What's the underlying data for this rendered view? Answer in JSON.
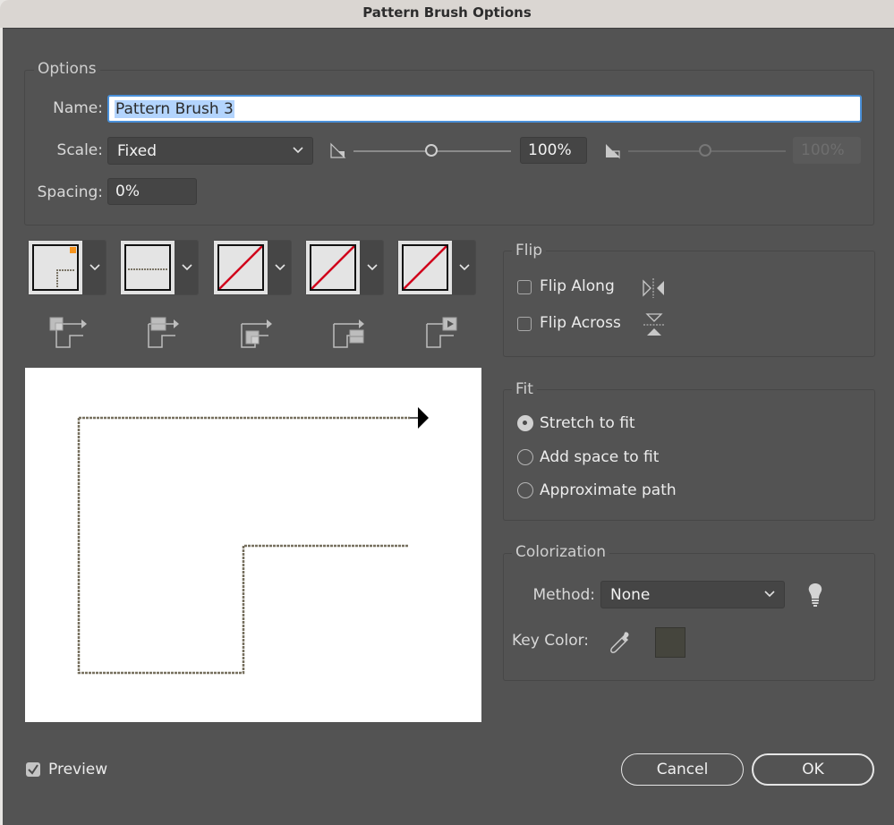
{
  "window": {
    "title": "Pattern Brush Options"
  },
  "options": {
    "group_title": "Options",
    "name_label": "Name:",
    "name_value": "Pattern Brush 3",
    "scale_label": "Scale:",
    "scale_value": "Fixed",
    "scale_slider_1": {
      "percent_value": 100,
      "text": "100%"
    },
    "scale_slider_2": {
      "percent_value": 100,
      "text": "100%",
      "disabled": true
    },
    "spacing_label": "Spacing:",
    "spacing_value": "0%"
  },
  "tiles": [
    {
      "name": "outer-corner-tile",
      "content": "corner-pattern",
      "selected_marker_color": "#f7941d"
    },
    {
      "name": "side-tile",
      "content": "straight-pattern"
    },
    {
      "name": "inner-corner-tile",
      "content": "none"
    },
    {
      "name": "start-tile",
      "content": "none"
    },
    {
      "name": "end-tile",
      "content": "none"
    }
  ],
  "tile_icons": [
    "outer-corner-tile-icon",
    "side-tile-icon",
    "inner-corner-tile-icon",
    "start-tile-icon",
    "end-tile-icon"
  ],
  "flip": {
    "group_title": "Flip",
    "flip_along": {
      "label": "Flip Along",
      "checked": false
    },
    "flip_across": {
      "label": "Flip Across",
      "checked": false
    }
  },
  "fit": {
    "group_title": "Fit",
    "options": [
      {
        "label": "Stretch to fit",
        "selected": true
      },
      {
        "label": "Add space to fit",
        "selected": false
      },
      {
        "label": "Approximate path",
        "selected": false
      }
    ]
  },
  "colorization": {
    "group_title": "Colorization",
    "method_label": "Method:",
    "method_value": "None",
    "key_color_label": "Key Color:",
    "key_color": "#45453d"
  },
  "footer": {
    "preview_label": "Preview",
    "preview_checked": true,
    "cancel_label": "Cancel",
    "ok_label": "OK"
  },
  "colors": {
    "dialog_bg": "#535353",
    "tile_none_line": "#d0021b",
    "focus_ring": "#4a90d9",
    "selection": "#b3d4fd"
  }
}
